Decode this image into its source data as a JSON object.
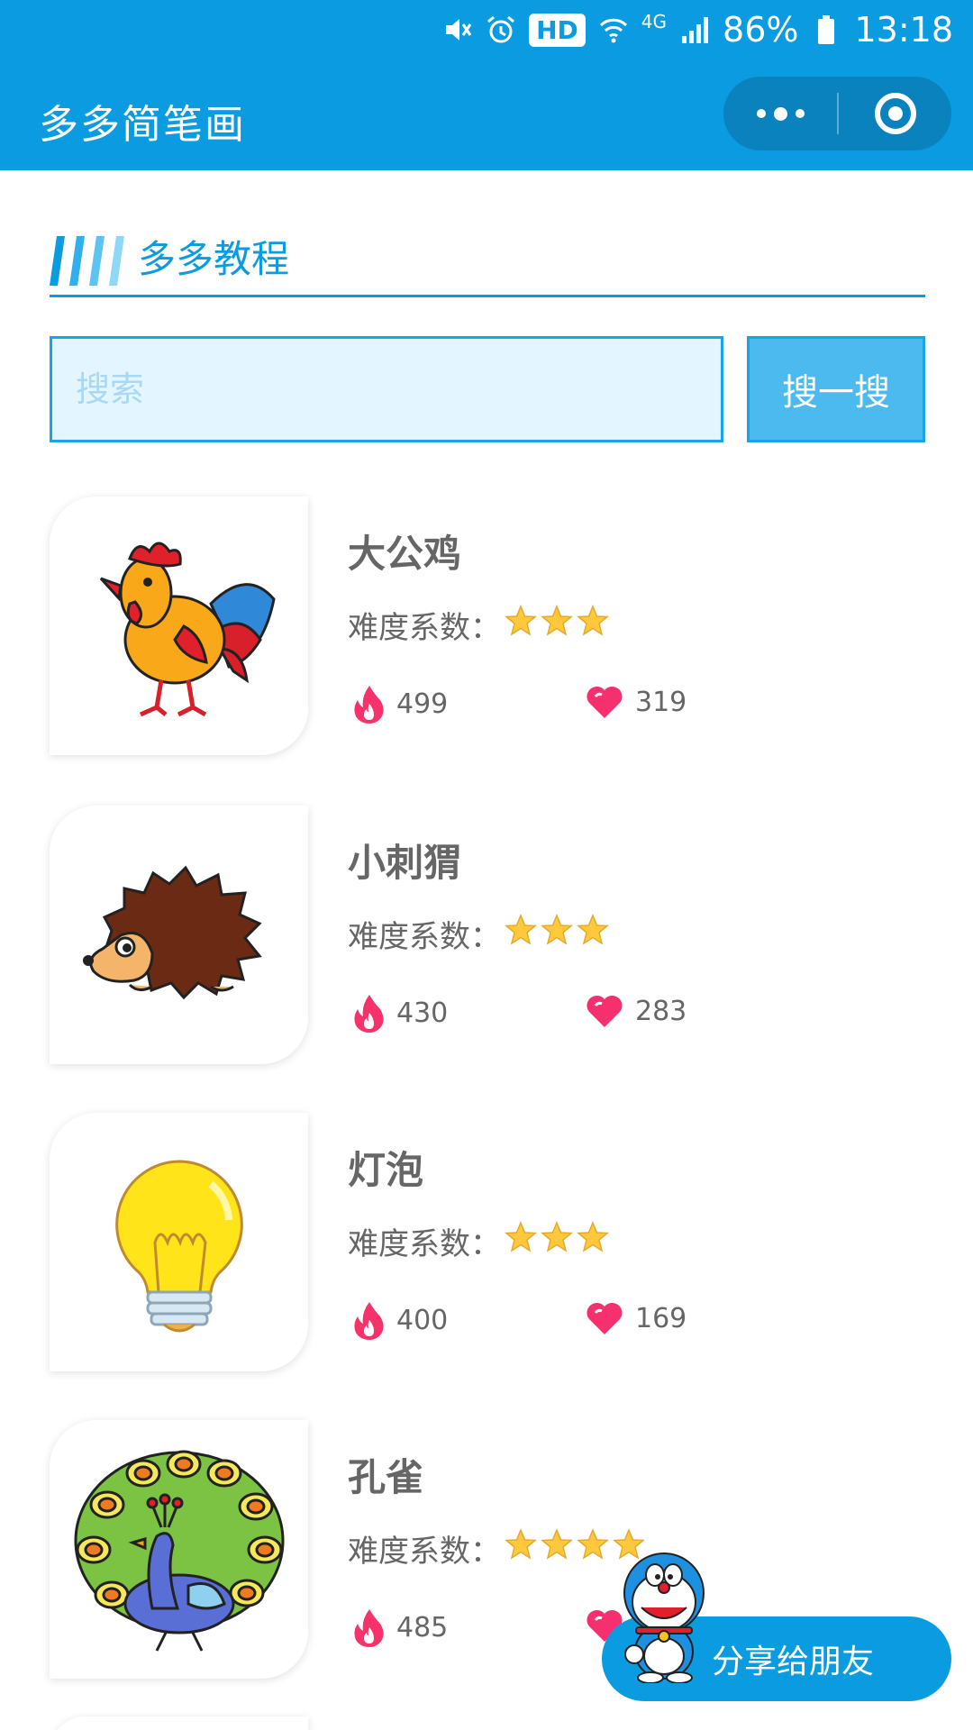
{
  "status_bar": {
    "hd_badge": "HD",
    "network": "4G",
    "battery": "86%",
    "time": "13:18"
  },
  "nav": {
    "title": "多多简笔画"
  },
  "section": {
    "title": "多多教程"
  },
  "search": {
    "placeholder": "搜索",
    "button_label": "搜一搜"
  },
  "difficulty_label": "难度系数：",
  "items": [
    {
      "name": "大公鸡",
      "stars": 3,
      "views": "499",
      "likes": "319",
      "thumb_icon": "rooster-image"
    },
    {
      "name": "小刺猬",
      "stars": 3,
      "views": "430",
      "likes": "283",
      "thumb_icon": "hedgehog-image"
    },
    {
      "name": "灯泡",
      "stars": 3,
      "views": "400",
      "likes": "169",
      "thumb_icon": "lightbulb-image"
    },
    {
      "name": "孔雀",
      "stars": 4,
      "views": "485",
      "likes": "",
      "thumb_icon": "peacock-image"
    }
  ],
  "share": {
    "label": "分享给朋友"
  },
  "colors": {
    "primary": "#0b9be0",
    "star": "#ffc83d",
    "heart": "#f6306e",
    "fire": "#f5326a"
  }
}
